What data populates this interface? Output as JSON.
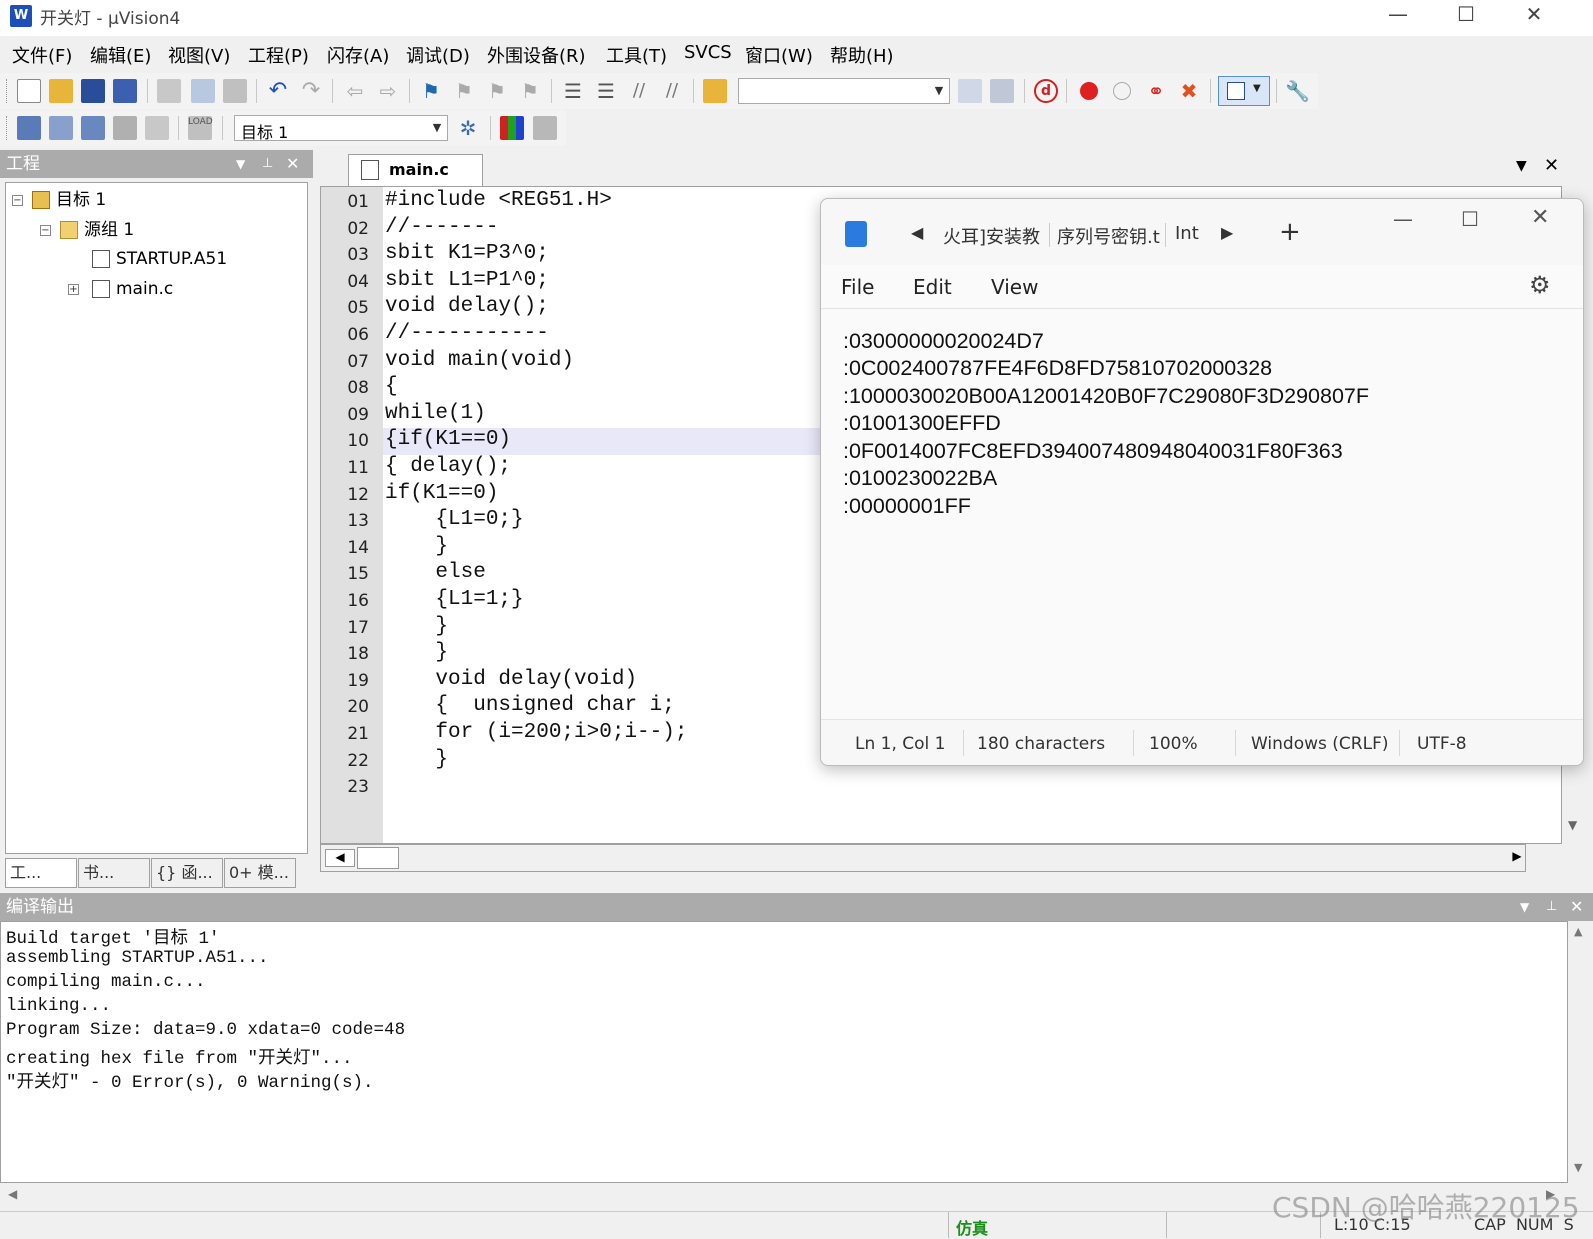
{
  "window": {
    "title": "开关灯  - µVision4",
    "minimize": "—",
    "maximize": "☐",
    "close": "✕"
  },
  "menu": [
    "文件(F)",
    "编辑(E)",
    "视图(V)",
    "工程(P)",
    "闪存(A)",
    "调试(D)",
    "外围设备(R)",
    "工具(T)",
    "SVCS",
    "窗口(W)",
    "帮助(H)"
  ],
  "toolbar2": {
    "target_select": "目标 1"
  },
  "project_panel": {
    "title": "工程",
    "tree": {
      "root": "目标 1",
      "group": "源组 1",
      "files": [
        "STARTUP.A51",
        "main.c"
      ]
    },
    "tabs": [
      "工...",
      "书...",
      "{} 函...",
      "0+ 模..."
    ]
  },
  "editor": {
    "tab": "main.c",
    "current_line": 10,
    "lines": [
      {
        "n": "01",
        "text": "#include <REG51.H>"
      },
      {
        "n": "02",
        "text": "//-------"
      },
      {
        "n": "03",
        "text": "sbit K1=P3^0;"
      },
      {
        "n": "04",
        "text": "sbit L1=P1^0;"
      },
      {
        "n": "05",
        "text": "void delay();"
      },
      {
        "n": "06",
        "text": "//-----------"
      },
      {
        "n": "07",
        "text": "void main(void)"
      },
      {
        "n": "08",
        "text": "{"
      },
      {
        "n": "09",
        "text": "while(1)"
      },
      {
        "n": "10",
        "text": "{if(K1==0)"
      },
      {
        "n": "11",
        "text": "{ delay();"
      },
      {
        "n": "12",
        "text": "if(K1==0)"
      },
      {
        "n": "13",
        "text": "    {L1=0;}"
      },
      {
        "n": "14",
        "text": "    }"
      },
      {
        "n": "15",
        "text": "    else"
      },
      {
        "n": "16",
        "text": "    {L1=1;}"
      },
      {
        "n": "17",
        "text": "    }"
      },
      {
        "n": "18",
        "text": "    }"
      },
      {
        "n": "19",
        "text": "    void delay(void)"
      },
      {
        "n": "20",
        "text": "    {  unsigned char i;"
      },
      {
        "n": "21",
        "text": "    for (i=200;i>0;i--);"
      },
      {
        "n": "22",
        "text": "    }"
      },
      {
        "n": "23",
        "text": ""
      }
    ]
  },
  "notepad": {
    "tabs": [
      "火耳]安装教",
      "序列号密钥.t",
      "Int"
    ],
    "new_tab": "+",
    "menu": [
      "File",
      "Edit",
      "View"
    ],
    "content": [
      ":03000000020024D7",
      ":0C002400787FE4F6D8FD75810702000328",
      ":1000030020B00A12001420B0F7C29080F3D290807F",
      ":01001300EFFD",
      ":0F0014007FC8EFD394007480948040031F80F363",
      ":0100230022BA",
      ":00000001FF"
    ],
    "status": {
      "position": "Ln 1, Col 1",
      "chars": "180 characters",
      "zoom": "100%",
      "line_ending": "Windows (CRLF)",
      "encoding": "UTF-8"
    }
  },
  "output": {
    "title": "编译输出",
    "lines": [
      "Build target '目标 1'",
      "assembling STARTUP.A51...",
      "compiling main.c...",
      "linking...",
      "Program Size: data=9.0 xdata=0 code=48",
      "creating hex file from \"开关灯\"...",
      "\"开关灯\" - 0 Error(s), 0 Warning(s)."
    ]
  },
  "status": {
    "mode": "仿真",
    "cursor": "L:10 C:15",
    "keys": "CAP  NUM  S"
  },
  "watermark": "CSDN @哈哈燕220125",
  "colors": {
    "accent_blue": "#1d4fb8",
    "current_line": "#e8e8f8",
    "sim_green": "#1a8f1a",
    "panel_header": "#ababab"
  }
}
